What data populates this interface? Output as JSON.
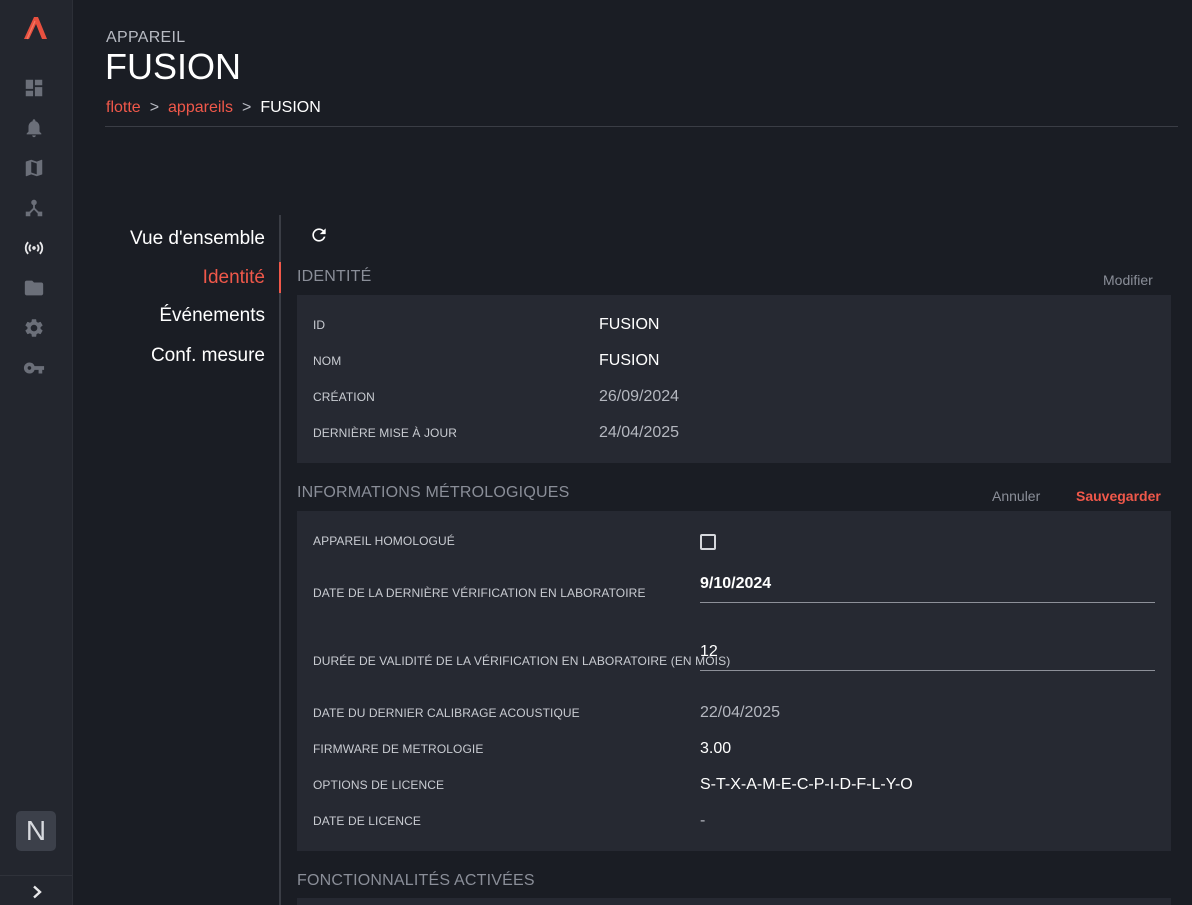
{
  "header": {
    "kicker": "APPAREIL",
    "title": "FUSION",
    "breadcrumb": [
      {
        "label": "flotte"
      },
      {
        "label": "appareils"
      },
      {
        "label": "FUSION"
      }
    ],
    "breadcrumb_separator": ">"
  },
  "rail": {
    "logo": "app-logo",
    "icons": [
      "dashboard-icon",
      "bell-icon",
      "map-icon",
      "network-icon",
      "broadcast-icon",
      "folder-icon",
      "gear-icon",
      "key-icon"
    ],
    "active_icon": "broadcast-icon",
    "avatar_letter": "N",
    "expand_icon": "chevron-right-icon"
  },
  "subnav": {
    "items": [
      {
        "label": "Vue d'ensemble",
        "active": false
      },
      {
        "label": "Identité",
        "active": true
      },
      {
        "label": "Événements",
        "active": false
      },
      {
        "label": "Conf. mesure",
        "active": false
      }
    ]
  },
  "identity": {
    "title": "IDENTITÉ",
    "edit_label": "Modifier",
    "rows": [
      {
        "label": "ID",
        "value": "FUSION"
      },
      {
        "label": "NOM",
        "value": "FUSION"
      },
      {
        "label": "CRÉATION",
        "value": "26/09/2024"
      },
      {
        "label": "DERNIÈRE MISE À JOUR",
        "value": "24/04/2025"
      }
    ]
  },
  "metrology": {
    "title": "INFORMATIONS MÉTROLOGIQUES",
    "cancel_label": "Annuler",
    "save_label": "Sauvegarder",
    "homologated_label": "APPAREIL HOMOLOGUÉ",
    "homologated_checked": false,
    "last_lab_check_label": "DATE DE LA DERNIÈRE VÉRIFICATION EN LABORATOIRE",
    "last_lab_check_value": "9/10/2024",
    "validity_label": "DURÉE DE VALIDITÉ DE LA VÉRIFICATION EN LABORATOIRE (EN MOIS)",
    "validity_value": "12",
    "rows": [
      {
        "label": "DATE DU DERNIER CALIBRAGE ACOUSTIQUE",
        "value": "22/04/2025"
      },
      {
        "label": "FIRMWARE DE METROLOGIE",
        "value": "3.00"
      },
      {
        "label": "OPTIONS DE LICENCE",
        "value": "S-T-X-A-M-E-C-P-I-D-F-L-Y-O"
      },
      {
        "label": "DATE DE LICENCE",
        "value": "-"
      }
    ]
  },
  "features": {
    "title": "FONCTIONNALITÉS ACTIVÉES"
  },
  "colors": {
    "accent": "#f0584a",
    "background": "#1a1d24",
    "rail": "#23262e",
    "card": "#262932"
  }
}
